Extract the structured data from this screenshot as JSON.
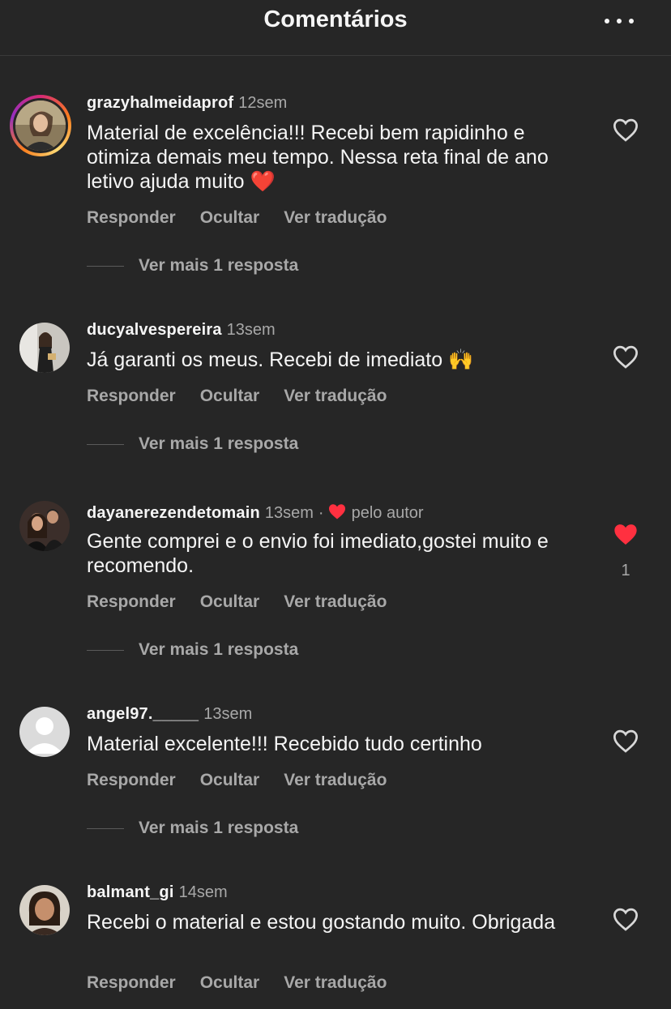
{
  "header": {
    "title": "Comentários",
    "more_icon": "more-horizontal-icon"
  },
  "colors": {
    "background": "#262626",
    "primary_text": "#f5f5f5",
    "secondary_text": "#a8a8a8",
    "like_red": "#ff3040"
  },
  "comments": [
    {
      "username": "grazyhalmeidaprof",
      "time": "12sem",
      "text": "Material de excelência!!! Recebi bem rapidinho e otimiza demais meu tempo. Nessa reta final de ano letivo ajuda muito",
      "emoji": "❤️",
      "has_story_ring": true,
      "liked": false,
      "actions": [
        "Responder",
        "Ocultar",
        "Ver tradução"
      ],
      "replies": "Ver mais 1 resposta"
    },
    {
      "username": "ducyalvespereira",
      "time": "13sem",
      "text": "Já garanti os meus. Recebi de imediato",
      "emoji": "🙌",
      "liked": false,
      "actions": [
        "Responder",
        "Ocultar",
        "Ver tradução"
      ],
      "replies": "Ver mais 1 resposta"
    },
    {
      "username": "dayanerezendetomain",
      "time": "13sem",
      "separator": "·",
      "author_like": "pelo autor",
      "text": "Gente comprei e o envio foi imediato,gostei muito e recomendo.",
      "liked": true,
      "like_count": "1",
      "actions": [
        "Responder",
        "Ocultar",
        "Ver tradução"
      ],
      "replies": "Ver mais 1 resposta"
    },
    {
      "username": "angel97._____",
      "time": "13sem",
      "text": "Material excelente!!! Recebido tudo certinho",
      "liked": false,
      "default_avatar": true,
      "actions": [
        "Responder",
        "Ocultar",
        "Ver tradução"
      ],
      "replies": "Ver mais 1 resposta"
    },
    {
      "username": "balmant_gi",
      "time": "14sem",
      "text": "Recebi o material e estou gostando muito. Obrigada",
      "liked": false,
      "actions": [
        "Responder",
        "Ocultar",
        "Ver tradução"
      ]
    }
  ]
}
